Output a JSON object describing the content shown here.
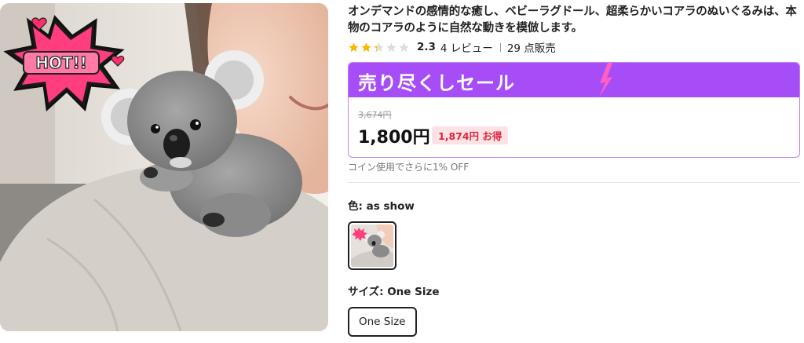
{
  "product": {
    "title": "オンデマンドの感情的な癒し、ベビーラグドール、超柔らかいコアラのぬいぐるみは、本物のコアラのように自然な動きを模倣します。",
    "rating": {
      "stars": 2.3,
      "value": "2.3",
      "reviews": "4 レビュー",
      "sold": "29 点販売"
    },
    "hot_badge": "HOT!!",
    "star_color": "#f5b800"
  },
  "sale": {
    "banner": "売り尽くしセール",
    "original_price": "3,674円",
    "price": "1,800円",
    "savings": "1,874円 お得",
    "accent_color": "#a64df7"
  },
  "coin_note": "コイン使用でさらに1% OFF",
  "options": {
    "color_label": "色: as show",
    "size_label": "サイズ: One Size",
    "size_value": "One Size"
  }
}
